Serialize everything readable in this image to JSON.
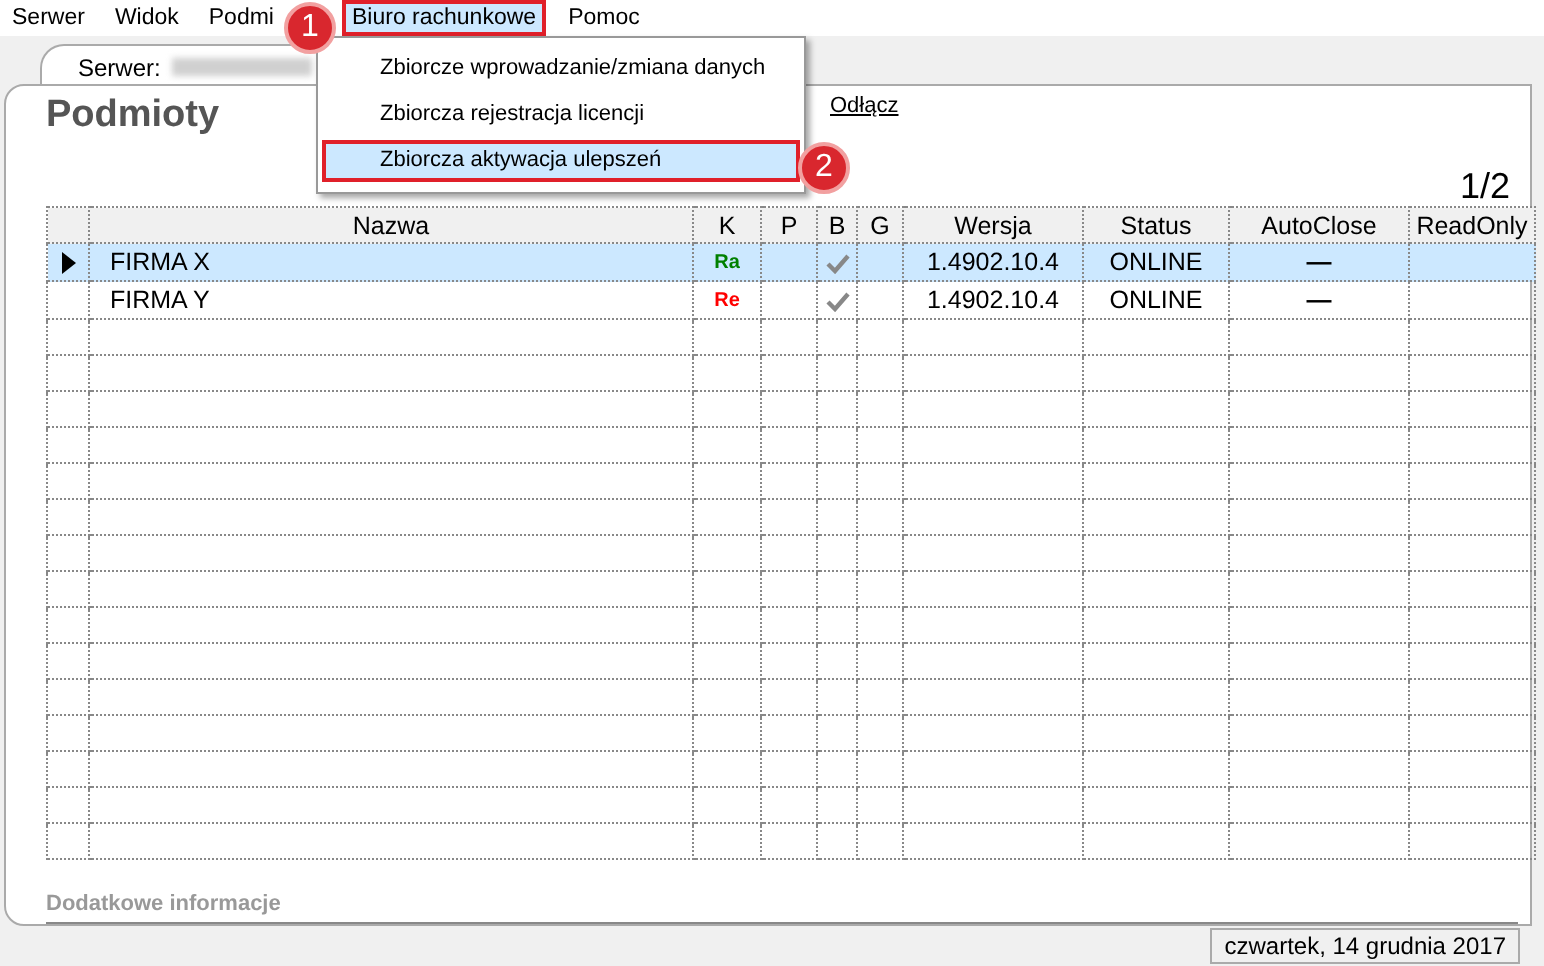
{
  "menu_bar": [
    {
      "label": "Serwer",
      "selected": false
    },
    {
      "label": "Widok",
      "selected": false
    },
    {
      "label": "Podmi",
      "selected": false
    },
    {
      "label": "Biuro rachunkowe",
      "selected": true
    },
    {
      "label": "Pomoc",
      "selected": false
    }
  ],
  "dropdown": [
    {
      "label": "Zbiorcze wprowadzanie/zmiana danych",
      "selected": false
    },
    {
      "label": "Zbiorcza rejestracja licencji",
      "selected": false
    },
    {
      "label": "Zbiorcza aktywacja ulepszeń",
      "selected": true
    }
  ],
  "callouts": [
    "1",
    "2"
  ],
  "server_tab": {
    "label": "Serwer:"
  },
  "panel": {
    "title": "Podmioty",
    "disconnect_link": "Odłącz",
    "page": "1/2"
  },
  "table": {
    "columns": [
      "Nazwa",
      "K",
      "P",
      "B",
      "G",
      "Wersja",
      "Status",
      "AutoClose",
      "ReadOnly"
    ],
    "rows": [
      {
        "selected": true,
        "name": "FIRMA X",
        "k": {
          "text": "Ra",
          "color": "#008000"
        },
        "b_checked": true,
        "version": "1.4902.10.4",
        "status": "ONLINE",
        "autoclose": "—"
      },
      {
        "selected": false,
        "name": "FIRMA Y",
        "k": {
          "text": "Re",
          "color": "#ff0000"
        },
        "b_checked": true,
        "version": "1.4902.10.4",
        "status": "ONLINE",
        "autoclose": "—"
      }
    ]
  },
  "info_label": "Dodatkowe informacje",
  "status_bar": {
    "date": "czwartek, 14 grudnia 2017"
  }
}
